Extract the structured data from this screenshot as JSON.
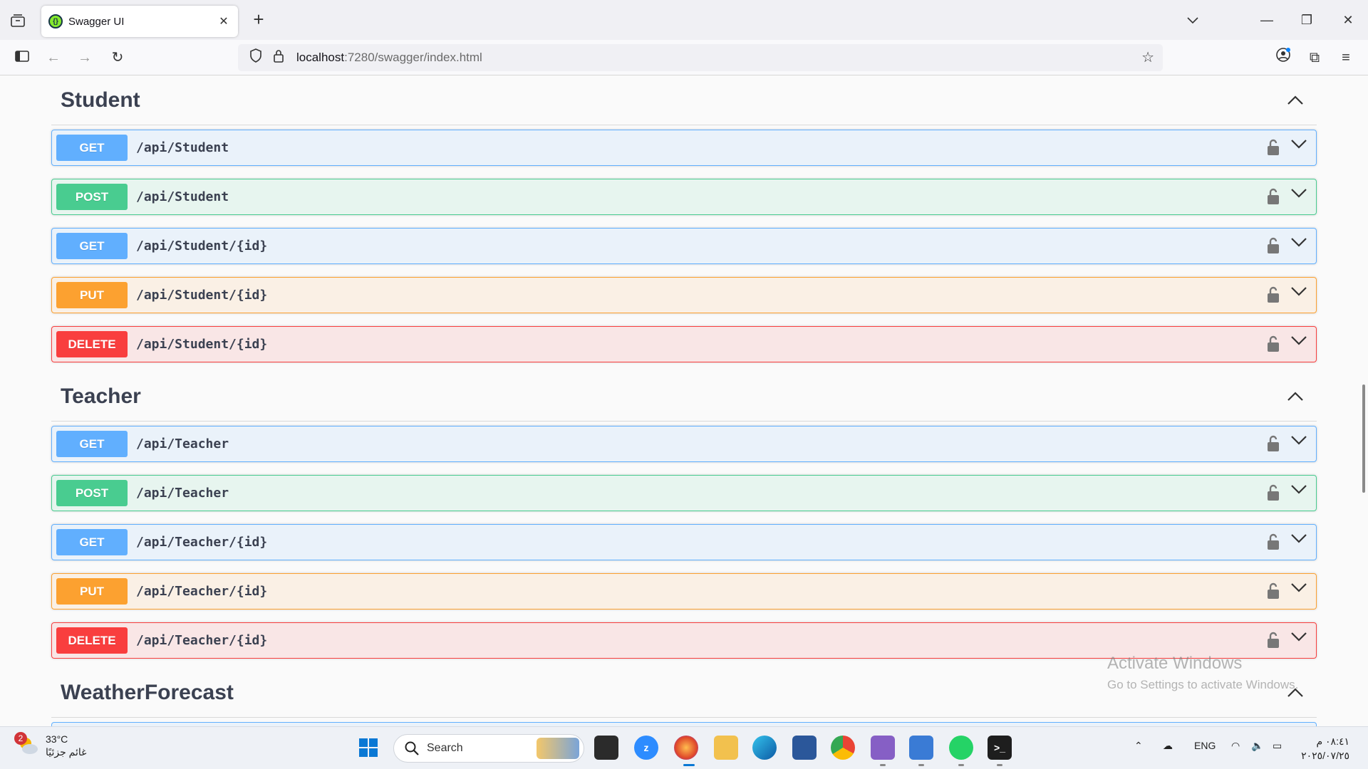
{
  "browser": {
    "tab_title": "Swagger UI",
    "url_host": "localhost",
    "url_rest": ":7280/swagger/index.html"
  },
  "sections": [
    {
      "title": "Student",
      "operations": [
        {
          "method": "GET",
          "path": "/api/Student"
        },
        {
          "method": "POST",
          "path": "/api/Student"
        },
        {
          "method": "GET",
          "path": "/api/Student/{id}"
        },
        {
          "method": "PUT",
          "path": "/api/Student/{id}"
        },
        {
          "method": "DELETE",
          "path": "/api/Student/{id}"
        }
      ]
    },
    {
      "title": "Teacher",
      "operations": [
        {
          "method": "GET",
          "path": "/api/Teacher"
        },
        {
          "method": "POST",
          "path": "/api/Teacher"
        },
        {
          "method": "GET",
          "path": "/api/Teacher/{id}"
        },
        {
          "method": "PUT",
          "path": "/api/Teacher/{id}"
        },
        {
          "method": "DELETE",
          "path": "/api/Teacher/{id}"
        }
      ]
    },
    {
      "title": "WeatherForecast",
      "operations": []
    }
  ],
  "watermark": {
    "line1": "Activate Windows",
    "line2": "Go to Settings to activate Windows."
  },
  "taskbar": {
    "weather_badge": "2",
    "temperature": "33°C",
    "weather_desc": "غائم جزئيًا",
    "search_label": "Search",
    "language": "ENG",
    "time": "٠٨:٤١ م",
    "date": "٢٠٢٥/٠٧/٢٥"
  },
  "colors": {
    "get": "#61affe",
    "post": "#49cc90",
    "put": "#fca130",
    "delete": "#f93e3e"
  }
}
